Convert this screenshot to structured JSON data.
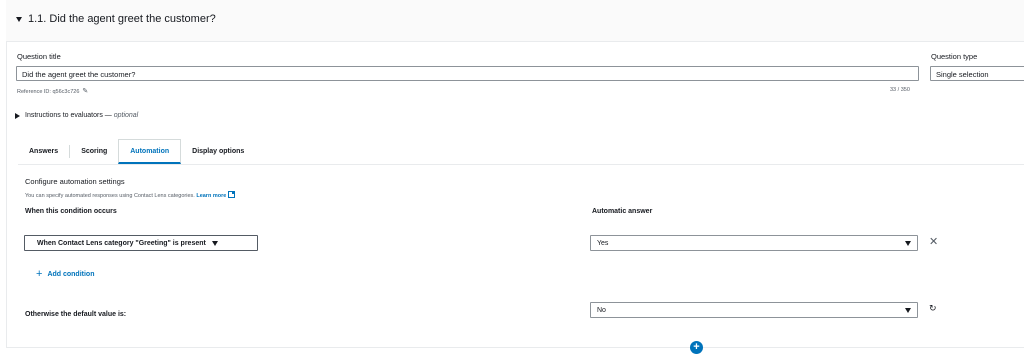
{
  "header": {
    "title": "1.1. Did the agent greet the customer?"
  },
  "question_title": {
    "label": "Question title",
    "value": "Did the agent greet the customer?",
    "reference": "Reference ID: q56c3c726",
    "char_count": "33 / 350"
  },
  "question_type": {
    "label": "Question type",
    "value": "Single selection"
  },
  "instructions": {
    "label": "Instructions to evaluators — ",
    "optional": "optional"
  },
  "tabs": [
    {
      "label": "Answers"
    },
    {
      "label": "Scoring"
    },
    {
      "label": "Automation"
    },
    {
      "label": "Display options"
    }
  ],
  "active_tab": "Automation",
  "automation": {
    "title": "Configure automation settings",
    "description": "You can specify automated responses using Contact Lens categories.",
    "learn_more": "Learn more",
    "condition_header": "When this condition occurs",
    "answer_header": "Automatic answer",
    "condition_value": "When Contact Lens category \"Greeting\" is present",
    "answer_value": "Yes",
    "add_condition": "Add condition",
    "default_label": "Otherwise the default value is:",
    "default_value": "No"
  },
  "colors": {
    "accent": "#0073bb",
    "text": "#16191f",
    "border": "#8d9399"
  }
}
